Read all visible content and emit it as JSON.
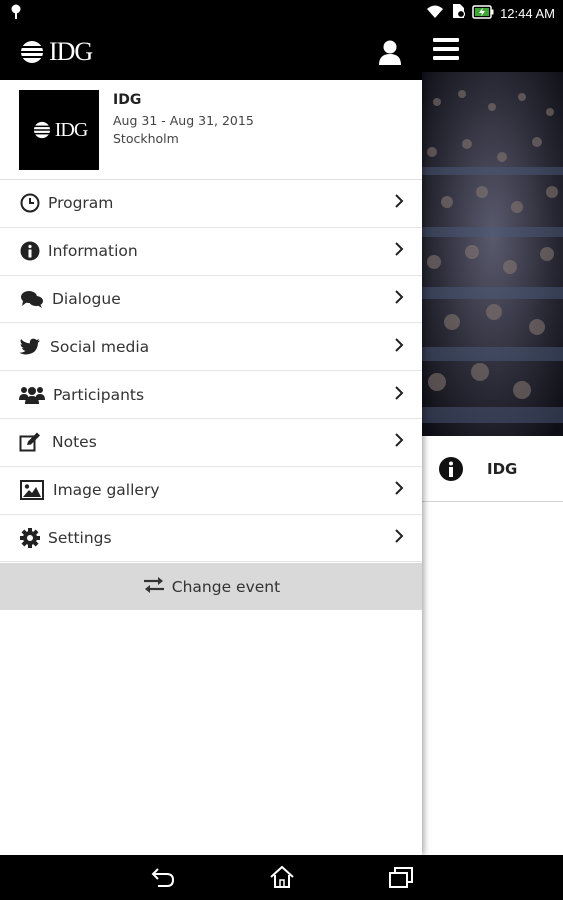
{
  "status_bar": {
    "time": "12:44 AM",
    "icons": [
      "location-pin-icon",
      "wifi-icon",
      "sim-icon",
      "battery-charging-icon"
    ]
  },
  "drawer": {
    "logo_text": "IDG",
    "user_icon": "user-icon",
    "event": {
      "logo_text": "IDG",
      "title": "IDG",
      "dates": "Aug 31 - Aug 31, 2015",
      "location": "Stockholm"
    },
    "menu": [
      {
        "label": "Program",
        "icon": "clock-icon"
      },
      {
        "label": "Information",
        "icon": "info-icon"
      },
      {
        "label": "Dialogue",
        "icon": "chat-icon"
      },
      {
        "label": "Social media",
        "icon": "twitter-icon"
      },
      {
        "label": "Participants",
        "icon": "people-icon"
      },
      {
        "label": "Notes",
        "icon": "edit-icon"
      },
      {
        "label": "Image gallery",
        "icon": "image-icon"
      },
      {
        "label": "Settings",
        "icon": "gear-icon"
      }
    ],
    "change_event_label": "Change event"
  },
  "content": {
    "event_row_label": "IDG"
  },
  "nav_bar": {
    "buttons": [
      "back-icon",
      "home-icon",
      "recents-icon"
    ]
  }
}
